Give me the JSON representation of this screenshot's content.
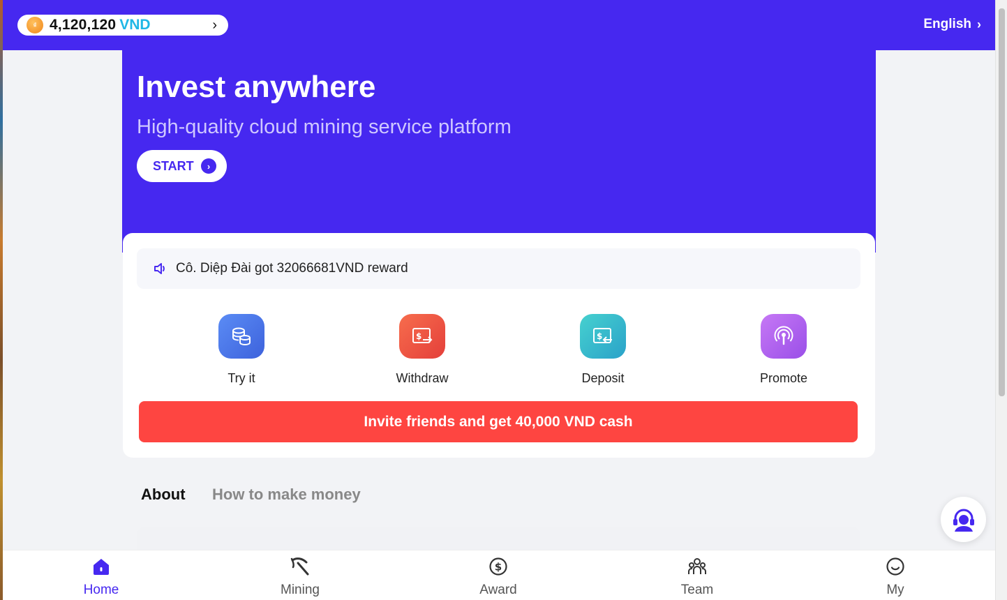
{
  "header": {
    "balance_amount": "4,120,120",
    "balance_currency": "VND",
    "language": "English"
  },
  "hero": {
    "title": "Invest anywhere",
    "subtitle": "High-quality cloud mining service platform",
    "start_label": "START"
  },
  "notice": {
    "text": "Cô. Diệp Đài got 32066681VND reward"
  },
  "actions": [
    {
      "label": "Try it",
      "icon": "coins-icon",
      "color": "#4b78ea"
    },
    {
      "label": "Withdraw",
      "icon": "withdraw-icon",
      "color": "#f0553f"
    },
    {
      "label": "Deposit",
      "icon": "deposit-icon",
      "color": "#2fb8c8"
    },
    {
      "label": "Promote",
      "icon": "broadcast-icon",
      "color": "#b45ef0"
    }
  ],
  "invite_banner": "Invite friends and get 40,000 VND cash",
  "tabs": [
    {
      "label": "About",
      "active": true
    },
    {
      "label": "How to make money",
      "active": false
    }
  ],
  "bottom_nav": [
    {
      "label": "Home",
      "icon": "home-icon",
      "active": true
    },
    {
      "label": "Mining",
      "icon": "pickaxe-icon",
      "active": false
    },
    {
      "label": "Award",
      "icon": "dollar-coin-icon",
      "active": false
    },
    {
      "label": "Team",
      "icon": "team-icon",
      "active": false
    },
    {
      "label": "My",
      "icon": "smiley-icon",
      "active": false
    }
  ],
  "colors": {
    "brand": "#4628f0",
    "invite": "#fe4541",
    "currency": "#1fb7e6"
  }
}
